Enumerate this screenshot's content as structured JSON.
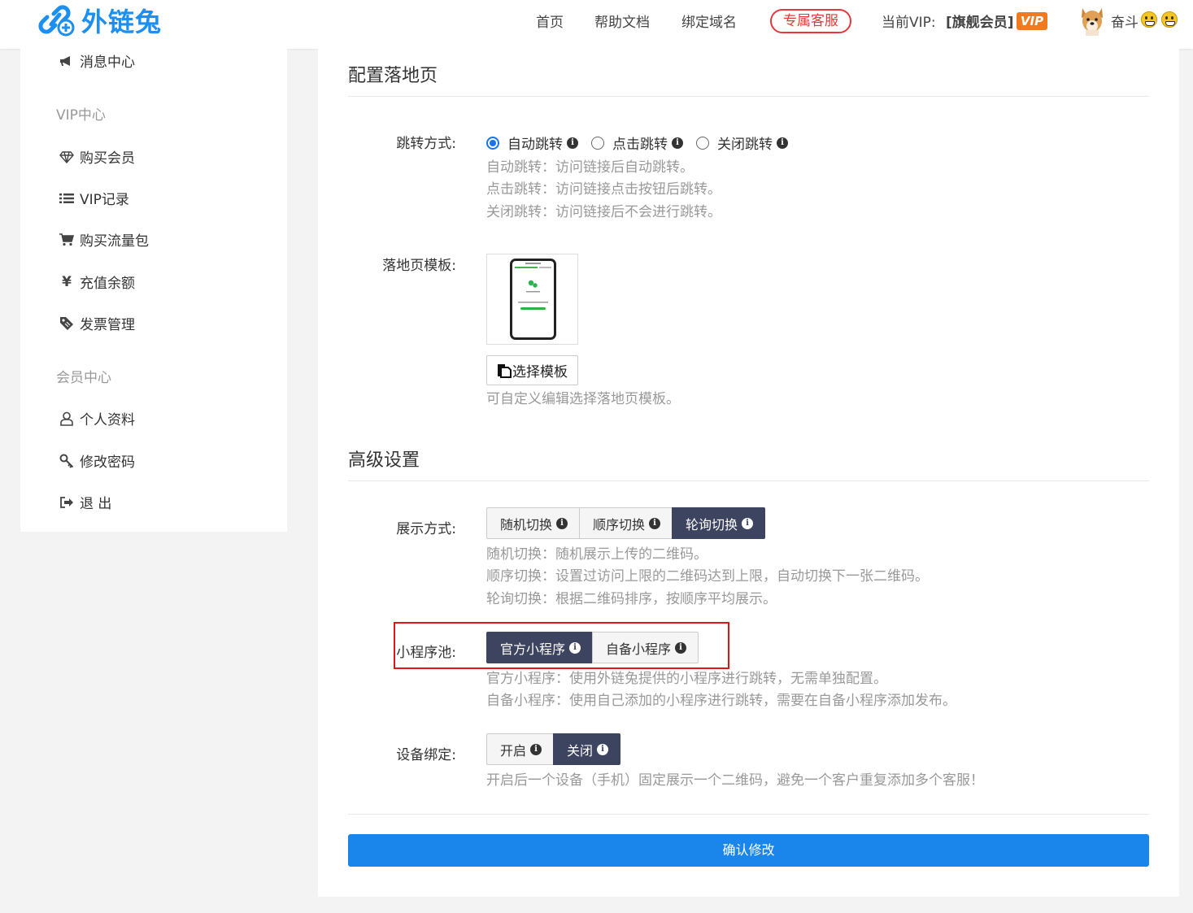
{
  "header": {
    "brand": "外链兔",
    "nav": [
      "首页",
      "帮助文档",
      "绑定域名"
    ],
    "service_button": "专属客服",
    "vip_label": "当前VIP:",
    "vip_level": "[旗舰会员]",
    "vip_badge": "VIP",
    "username": "奋斗",
    "colors": {
      "brand": "#1d8ff0",
      "service": "#e4393c",
      "vip_badge": "#f17a1f"
    }
  },
  "sidebar": {
    "top_item": {
      "label": "消息中心",
      "icon": "megaphone-icon"
    },
    "vip_group": "VIP中心",
    "vip_items": [
      {
        "label": "购买会员",
        "icon": "diamond-icon"
      },
      {
        "label": "VIP记录",
        "icon": "list-icon"
      },
      {
        "label": "购买流量包",
        "icon": "cart-icon"
      },
      {
        "label": "充值余额",
        "icon": "yen-icon"
      },
      {
        "label": "发票管理",
        "icon": "ticket-icon"
      }
    ],
    "member_group": "会员中心",
    "member_items": [
      {
        "label": "个人资料",
        "icon": "user-icon"
      },
      {
        "label": "修改密码",
        "icon": "key-icon"
      },
      {
        "label": "退 出",
        "icon": "logout-icon"
      }
    ]
  },
  "landing": {
    "title": "配置落地页",
    "jump_label": "跳转方式:",
    "jump_options": [
      {
        "label": "自动跳转",
        "selected": true
      },
      {
        "label": "点击跳转",
        "selected": false
      },
      {
        "label": "关闭跳转",
        "selected": false
      }
    ],
    "jump_help": [
      "自动跳转：访问链接后自动跳转。",
      "点击跳转：访问链接点击按钮后跳转。",
      "关闭跳转：访问链接后不会进行跳转。"
    ],
    "template_label": "落地页模板:",
    "template_button": "选择模板",
    "template_help": "可自定义编辑选择落地页模板。"
  },
  "advanced": {
    "title": "高级设置",
    "display_label": "展示方式:",
    "display_options": [
      "随机切换",
      "顺序切换",
      "轮询切换"
    ],
    "display_active": "轮询切换",
    "display_help": [
      "随机切换：随机展示上传的二维码。",
      "顺序切换：设置过访问上限的二维码达到上限，自动切换下一张二维码。",
      "轮询切换：根据二维码排序，按顺序平均展示。"
    ],
    "pool_label": "小程序池:",
    "pool_options": [
      "官方小程序",
      "自备小程序"
    ],
    "pool_active": "官方小程序",
    "pool_help": [
      "官方小程序：使用外链兔提供的小程序进行跳转，无需单独配置。",
      "自备小程序：使用自己添加的小程序进行跳转，需要在自备小程序添加发布。"
    ],
    "device_label": "设备绑定:",
    "device_options": [
      "开启",
      "关闭"
    ],
    "device_active": "关闭",
    "device_help": "开启后一个设备（手机）固定展示一个二维码，避免一个客户重复添加多个客服！"
  },
  "submit_label": "确认修改"
}
